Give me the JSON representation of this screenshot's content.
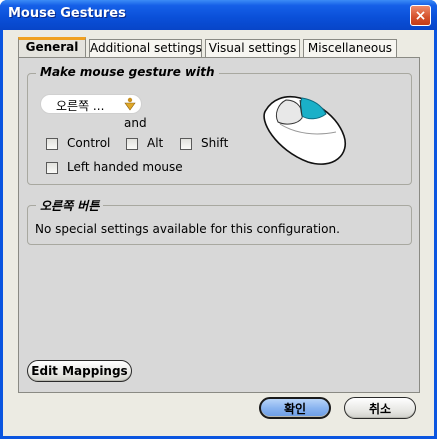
{
  "window": {
    "title": "Mouse Gestures",
    "close_icon": "×"
  },
  "tabs": [
    {
      "label": "General",
      "active": true
    },
    {
      "label": "Additional settings",
      "active": false
    },
    {
      "label": "Visual settings",
      "active": false
    },
    {
      "label": "Miscellaneous",
      "active": false
    }
  ],
  "gesture_group": {
    "legend": "Make mouse gesture with",
    "button_select": {
      "value": "오른쪽 ..."
    },
    "and_label": "and",
    "modifiers": [
      {
        "label": "Control",
        "checked": false
      },
      {
        "label": "Alt",
        "checked": false
      },
      {
        "label": "Shift",
        "checked": false
      }
    ],
    "left_handed": {
      "label": "Left handed mouse",
      "checked": false
    },
    "mouse_icon": "mouse-right-button-icon"
  },
  "button_settings": {
    "legend": "오른쪽 버튼",
    "message": "No special settings available for this configuration."
  },
  "edit_mappings_label": "Edit Mappings",
  "ok_label": "확인",
  "cancel_label": "취소",
  "colors": {
    "titlebar": "#0a55e0",
    "active_tab_accent": "#f0a020",
    "mouse_button_highlight": "#1ab0c8"
  }
}
